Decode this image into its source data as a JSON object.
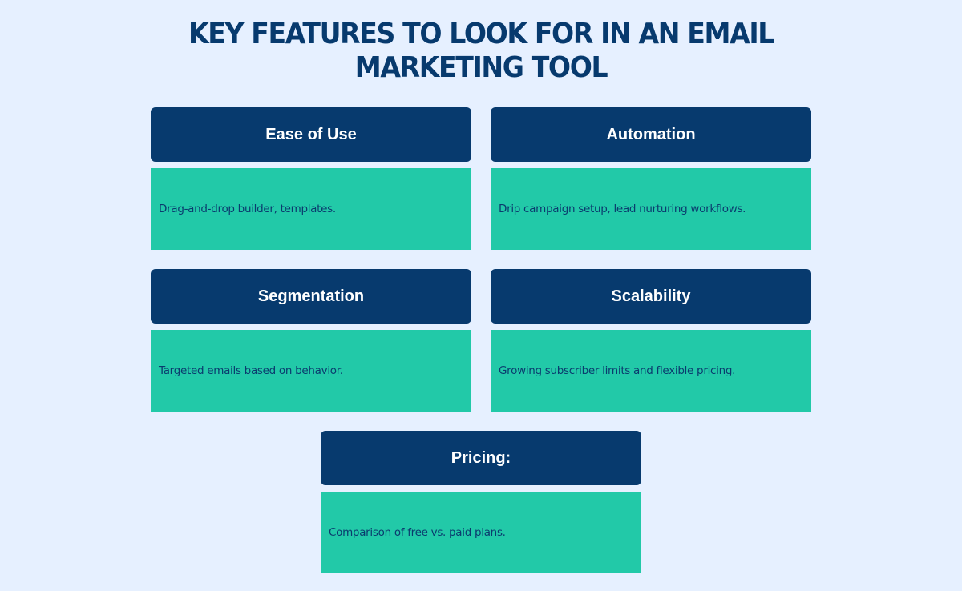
{
  "title": {
    "line1": "Key Features to Look for in an Email",
    "line2": "Marketing Tool"
  },
  "colors": {
    "background": "#e6f0ff",
    "header": "#073a6e",
    "body": "#22c9a8",
    "header_text": "#ffffff",
    "body_text": "#0b3b6e"
  },
  "features": [
    {
      "title": "Ease of Use",
      "description": "Drag-and-drop builder, templates."
    },
    {
      "title": "Automation",
      "description": "Drip campaign setup, lead nurturing workflows."
    },
    {
      "title": "Segmentation",
      "description": "Targeted emails based on behavior."
    },
    {
      "title": "Scalability",
      "description": "Growing subscriber limits and flexible pricing."
    },
    {
      "title": "Pricing:",
      "description": "Comparison of free vs. paid plans."
    }
  ]
}
